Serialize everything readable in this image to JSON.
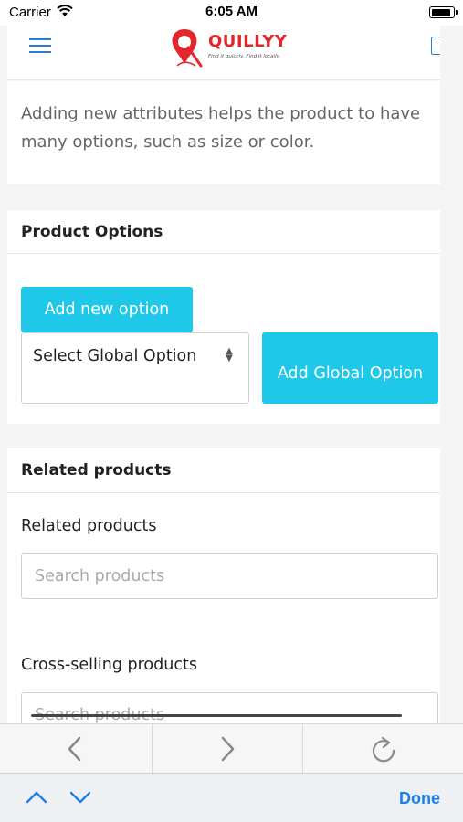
{
  "status_bar": {
    "carrier": "Carrier",
    "time": "6:05 AM",
    "battery_level": 0.9
  },
  "header": {
    "brand": "QUILLYY",
    "tagline": "Find it quickly. Find it locally.",
    "accent_color": "#e4262c",
    "menu_icon": "hamburger-icon"
  },
  "intro": {
    "text": "Adding new attributes helps the product to have many options, such as size or color."
  },
  "product_options": {
    "title": "Product Options",
    "add_new_label": "Add new option",
    "select_value": "Select Global Option",
    "add_global_label": "Add Global Option",
    "button_color": "#1ec8e8"
  },
  "related": {
    "title": "Related products",
    "related_label": "Related products",
    "related_placeholder": "Search products",
    "cross_label": "Cross-selling products",
    "cross_placeholder": "Search products"
  },
  "browser": {
    "icons": [
      "back-icon",
      "forward-icon",
      "reload-icon"
    ]
  },
  "accessory": {
    "done_label": "Done",
    "icons": [
      "chevron-up-icon",
      "chevron-down-icon"
    ],
    "accent_color": "#1c7fe8"
  }
}
